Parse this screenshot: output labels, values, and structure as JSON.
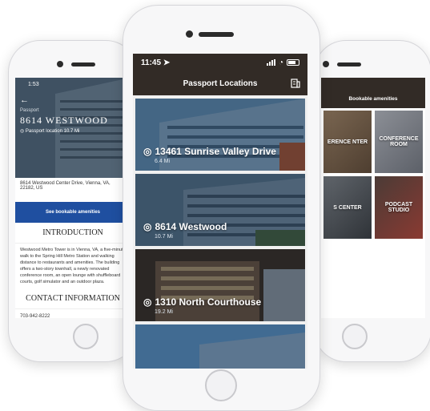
{
  "center": {
    "status_time": "11:45",
    "nav_title": "Passport Locations",
    "locations": [
      {
        "name": "13461 Sunrise Valley Drive",
        "distance": "6.4 Mi"
      },
      {
        "name": "8614 Westwood",
        "distance": "10.7 Mi"
      },
      {
        "name": "1310 North Courthouse",
        "distance": "19.2 Mi"
      }
    ]
  },
  "left": {
    "status_time": "1:53",
    "hero_label": "Passport",
    "hero_title": "8614 WESTWOOD",
    "hero_sub": "Passport location  10.7 Mi",
    "address": "8614 Westwood Center Drive, Vienna, VA, 22182, US",
    "amenities_button": "See bookable amenities",
    "intro_heading": "INTRODUCTION",
    "intro_body": "Westwood Metro Tower is in Vienna, VA, a five-minute walk to the Spring Hill Metro Station and walking distance to restaurants and amenities. The building offers a two-story townhall, a newly renovated conference room, an open lounge with shuffleboard courts, golf simulator and an outdoor plaza.",
    "contact_heading": "CONTACT INFORMATION",
    "phone": "703-942-8222"
  },
  "right": {
    "header": "Bookable amenities",
    "tiles": [
      "ERENCE NTER",
      "CONFERENCE ROOM",
      "S CENTER",
      "PODCAST STUDIO"
    ]
  },
  "colors": {
    "header_bg": "#322b26",
    "button_blue": "#1f4fa0"
  }
}
